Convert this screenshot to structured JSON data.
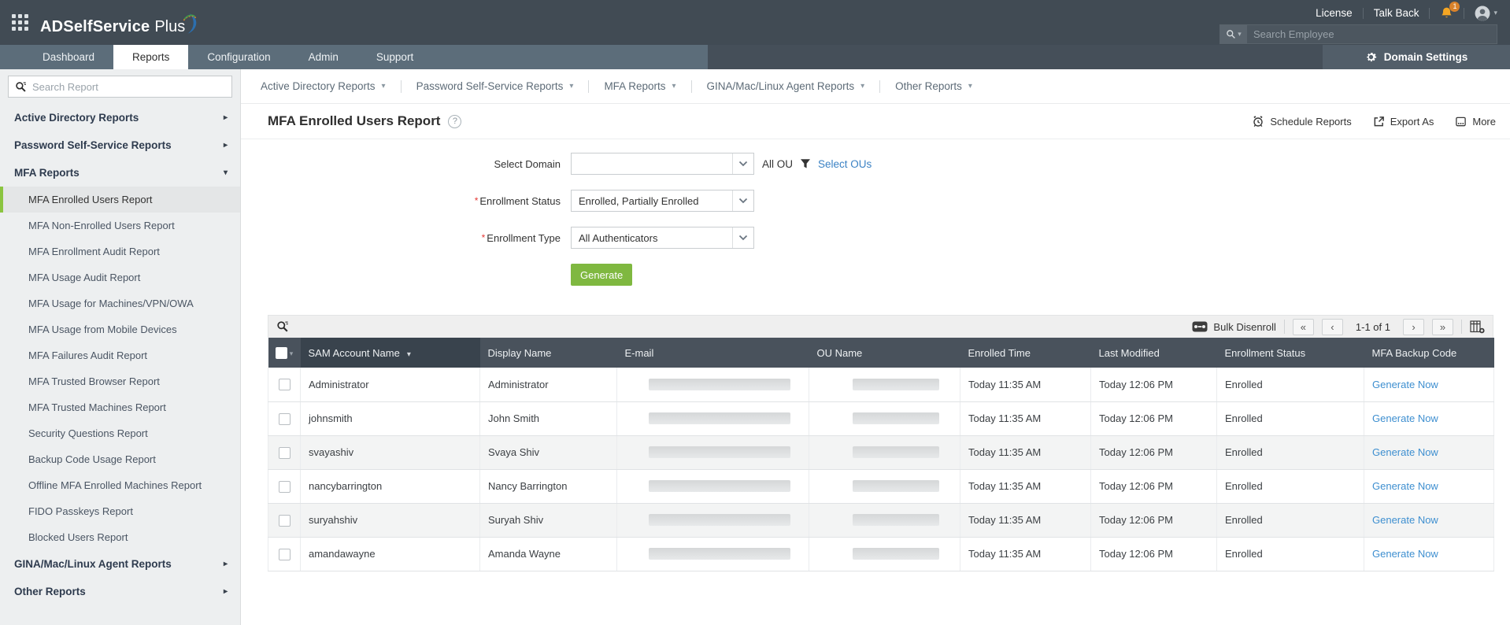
{
  "colors": {
    "accent_green": "#7FB840",
    "selected_green_bar": "#8BC540",
    "link_blue": "#3E8FD0",
    "badge_orange": "#D9822B",
    "header_dark": "#414B54",
    "table_header": "#49525C"
  },
  "header": {
    "brand": "ADSelfService",
    "brand_suffix": "Plus",
    "license_label": "License",
    "talkback_label": "Talk Back",
    "notification_count": "1",
    "employee_search_placeholder": "Search Employee"
  },
  "nav": {
    "tabs": [
      {
        "label": "Dashboard"
      },
      {
        "label": "Reports"
      },
      {
        "label": "Configuration"
      },
      {
        "label": "Admin"
      },
      {
        "label": "Support"
      }
    ],
    "domain_settings_label": "Domain Settings"
  },
  "sidebar": {
    "search_placeholder": "Search Report",
    "items": [
      {
        "label": "Active Directory Reports",
        "type": "category"
      },
      {
        "label": "Password Self-Service Reports",
        "type": "category"
      },
      {
        "label": "MFA Reports",
        "type": "category",
        "expanded": true
      },
      {
        "label": "MFA Enrolled Users Report",
        "type": "sub",
        "selected": true
      },
      {
        "label": "MFA Non-Enrolled Users Report",
        "type": "sub"
      },
      {
        "label": "MFA Enrollment Audit Report",
        "type": "sub"
      },
      {
        "label": "MFA Usage Audit Report",
        "type": "sub"
      },
      {
        "label": "MFA Usage for Machines/VPN/OWA",
        "type": "sub"
      },
      {
        "label": "MFA Usage from Mobile Devices",
        "type": "sub"
      },
      {
        "label": "MFA Failures Audit Report",
        "type": "sub"
      },
      {
        "label": "MFA Trusted Browser Report",
        "type": "sub"
      },
      {
        "label": "MFA Trusted Machines Report",
        "type": "sub"
      },
      {
        "label": "Security Questions Report",
        "type": "sub"
      },
      {
        "label": "Backup Code Usage Report",
        "type": "sub"
      },
      {
        "label": "Offline MFA Enrolled Machines Report",
        "type": "sub"
      },
      {
        "label": "FIDO Passkeys Report",
        "type": "sub"
      },
      {
        "label": "Blocked Users Report",
        "type": "sub"
      },
      {
        "label": "GINA/Mac/Linux Agent Reports",
        "type": "category"
      },
      {
        "label": "Other Reports",
        "type": "category"
      }
    ]
  },
  "menubar": {
    "items": [
      "Active Directory Reports",
      "Password Self-Service Reports",
      "MFA Reports",
      "GINA/Mac/Linux Agent Reports",
      "Other Reports"
    ]
  },
  "report": {
    "title": "MFA Enrolled Users Report",
    "help_glyph": "?",
    "actions": {
      "schedule": "Schedule Reports",
      "export": "Export As",
      "more": "More"
    },
    "form": {
      "required_marker": "*",
      "domain_label": "Select Domain",
      "all_ou_label": "All OU",
      "select_ous_label": "Select OUs",
      "status_label": "Enrollment Status",
      "status_value": "Enrolled, Partially Enrolled",
      "type_label": "Enrollment Type",
      "type_value": "All Authenticators",
      "generate_label": "Generate"
    },
    "toolbar": {
      "bulk_disenroll_label": "Bulk Disenroll",
      "pagination": {
        "first": "«",
        "prev": "‹",
        "label": "1-1 of 1",
        "next": "›",
        "last": "»"
      }
    },
    "table": {
      "columns": [
        "SAM Account Name",
        "Display Name",
        "E-mail",
        "OU Name",
        "Enrolled Time",
        "Last Modified",
        "Enrollment Status",
        "MFA Backup Code"
      ],
      "rows": [
        {
          "sam": "Administrator",
          "display": "Administrator",
          "enrolled": "Today 11:35 AM",
          "modified": "Today 12:06 PM",
          "status": "Enrolled",
          "backup": "Generate Now"
        },
        {
          "sam": "johnsmith",
          "display": "John Smith",
          "enrolled": "Today 11:35 AM",
          "modified": "Today 12:06 PM",
          "status": "Enrolled",
          "backup": "Generate Now"
        },
        {
          "sam": "svayashiv",
          "display": "Svaya Shiv",
          "enrolled": "Today 11:35 AM",
          "modified": "Today 12:06 PM",
          "status": "Enrolled",
          "backup": "Generate Now"
        },
        {
          "sam": "nancybarrington",
          "display": "Nancy Barrington",
          "enrolled": "Today 11:35 AM",
          "modified": "Today 12:06 PM",
          "status": "Enrolled",
          "backup": "Generate Now"
        },
        {
          "sam": "suryahshiv",
          "display": "Suryah Shiv",
          "enrolled": "Today 11:35 AM",
          "modified": "Today 12:06 PM",
          "status": "Enrolled",
          "backup": "Generate Now"
        },
        {
          "sam": "amandawayne",
          "display": "Amanda Wayne",
          "enrolled": "Today 11:35 AM",
          "modified": "Today 12:06 PM",
          "status": "Enrolled",
          "backup": "Generate Now"
        }
      ]
    }
  }
}
